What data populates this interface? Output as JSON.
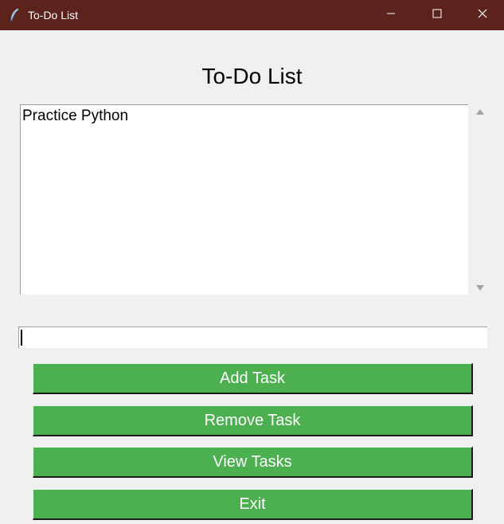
{
  "window": {
    "title": "To-Do List",
    "icon": "feather-icon",
    "titlebar_color": "#5c231c"
  },
  "heading": "To-Do List",
  "tasks": [
    "Practice Python"
  ],
  "entry": {
    "value": ""
  },
  "buttons": {
    "add": "Add Task",
    "remove": "Remove Task",
    "view": "View Tasks",
    "exit": "Exit"
  },
  "colors": {
    "button_bg": "#4caf50",
    "button_text": "#ffffff",
    "background": "#f0f0f0"
  }
}
